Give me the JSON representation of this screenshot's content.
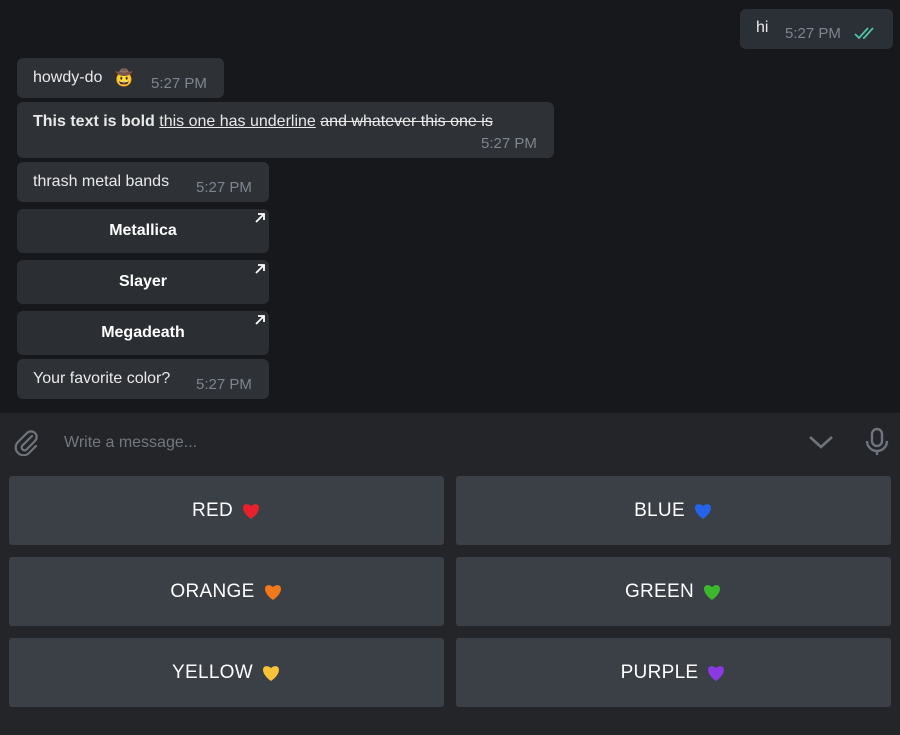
{
  "messages": {
    "outgoing": {
      "text": "hi",
      "time": "5:27 PM"
    },
    "howdy": {
      "text": "howdy-do",
      "emoji": "🤠",
      "time": "5:27 PM"
    },
    "formatted": {
      "bold": "This text is bold",
      "underline": "this one has underline",
      "strike": "and whatever this one is",
      "time": "5:27 PM"
    },
    "bands": {
      "text": "thrash metal bands",
      "time": "5:27 PM"
    },
    "color_q": {
      "text": "Your favorite color?",
      "time": "5:27 PM"
    }
  },
  "inline_buttons": [
    "Metallica",
    "Slayer",
    "Megadeath"
  ],
  "composer": {
    "placeholder": "Write a message..."
  },
  "keyboard": [
    {
      "label": "RED",
      "color": "#e8202d"
    },
    {
      "label": "BLUE",
      "color": "#2563eb"
    },
    {
      "label": "ORANGE",
      "color": "#f07a1a"
    },
    {
      "label": "GREEN",
      "color": "#3db82e"
    },
    {
      "label": "YELLOW",
      "color": "#f7c338"
    },
    {
      "label": "PURPLE",
      "color": "#8a3ae0"
    }
  ],
  "colors": {
    "bubble": "#2e3136",
    "timestamp": "#7d8590",
    "read_check": "#4fc3a9"
  }
}
